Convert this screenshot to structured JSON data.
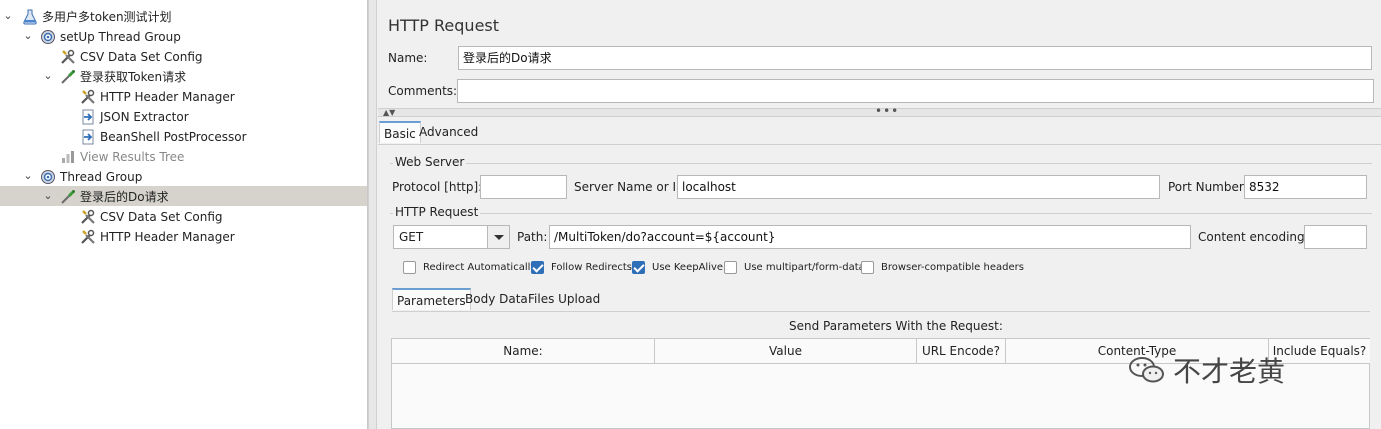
{
  "tree": {
    "items": [
      {
        "label": "多用户多token测试计划",
        "icon": "flask-icon"
      },
      {
        "label": "setUp Thread Group",
        "icon": "gear-icon"
      },
      {
        "label": "CSV Data Set Config",
        "icon": "wrench-icon"
      },
      {
        "label": "登录获取Token请求",
        "icon": "pipette-icon"
      },
      {
        "label": "HTTP Header Manager",
        "icon": "wrench-icon"
      },
      {
        "label": "JSON Extractor",
        "icon": "document-arrow-icon"
      },
      {
        "label": "BeanShell PostProcessor",
        "icon": "document-arrow-icon"
      },
      {
        "label": "View Results Tree",
        "icon": "chart-icon"
      },
      {
        "label": "Thread Group",
        "icon": "gear-icon"
      },
      {
        "label": "登录后的Do请求",
        "icon": "pipette-icon"
      },
      {
        "label": "CSV Data Set Config",
        "icon": "wrench-icon"
      },
      {
        "label": "HTTP Header Manager",
        "icon": "wrench-icon"
      }
    ]
  },
  "panel": {
    "title": "HTTP Request",
    "name_label": "Name:",
    "name_value": "登录后的Do请求",
    "comments_label": "Comments:",
    "comments_value": "",
    "tabs": [
      {
        "label": "Basic"
      },
      {
        "label": "Advanced"
      }
    ],
    "web_server": {
      "legend": "Web Server",
      "protocol_label": "Protocol [http]:",
      "protocol_value": "",
      "server_label": "Server Name or IP:",
      "server_value": "localhost",
      "port_label": "Port Number:",
      "port_value": "8532"
    },
    "http_request": {
      "legend": "HTTP Request",
      "method": "GET",
      "path_label": "Path:",
      "path_value": "/MultiToken/do?account=${account}",
      "encoding_label": "Content encoding:",
      "encoding_value": ""
    },
    "options": [
      {
        "label": "Redirect Automatically",
        "checked": false
      },
      {
        "label": "Follow Redirects",
        "checked": true
      },
      {
        "label": "Use KeepAlive",
        "checked": true
      },
      {
        "label": "Use multipart/form-data",
        "checked": false
      },
      {
        "label": "Browser-compatible headers",
        "checked": false
      }
    ],
    "sub_tabs": [
      {
        "label": "Parameters"
      },
      {
        "label": "Body Data"
      },
      {
        "label": "Files Upload"
      }
    ],
    "params_caption": "Send Parameters With the Request:",
    "columns": [
      "Name:",
      "Value",
      "URL Encode?",
      "Content-Type",
      "Include Equals?"
    ]
  },
  "watermark": {
    "text": "不才老黄"
  }
}
